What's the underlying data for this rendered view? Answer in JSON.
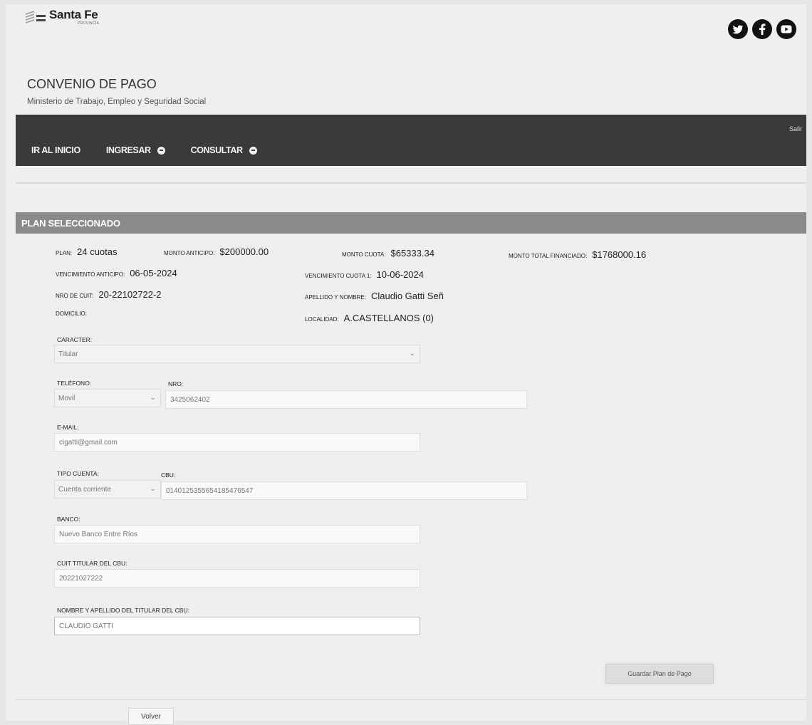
{
  "brand": {
    "name": "Santa Fe",
    "sub": "PROVINCIA"
  },
  "social_icons": [
    "twitter-icon",
    "facebook-icon",
    "youtube-icon"
  ],
  "header": {
    "title": "CONVENIO DE PAGO",
    "subtitle": "Ministerio de Trabajo, Empleo y Seguridad Social"
  },
  "nav": {
    "exit": "Salir",
    "home": "IR AL INICIO",
    "ingresar": "INGRESAR",
    "consultar": "CONSULTAR"
  },
  "section_title": "PLAN SELECCIONADO",
  "plan": {
    "plan_label": "PLAN:",
    "plan_value": "24 cuotas",
    "anticipo_label": "MONTO ANTICIPO:",
    "anticipo_value": "$200000.00",
    "cuota_label": "MONTO CUOTA:",
    "cuota_value": "$65333.34",
    "total_label": "MONTO TOTAL FINANCIADO:",
    "total_value": "$1768000.16",
    "venc_anticipo_label": "VENCIMIENTO ANTICIPO:",
    "venc_anticipo_value": "06-05-2024",
    "venc_cuota_label": "VENCIMIENTO CUOTA 1:",
    "venc_cuota_value": "10-06-2024",
    "cuit_label": "NRO DE CUIT:",
    "cuit_value": "20-22102722-2",
    "nombre_label": "APELLIDO Y NOMBRE:",
    "nombre_value": "Claudio Gatti Señ",
    "domicilio_label": "DOMICILIO:",
    "domicilio_value": "",
    "localidad_label": "LOCALIDAD:",
    "localidad_value": "A.CASTELLANOS (0)"
  },
  "form": {
    "caracter_label": "CARACTER:",
    "caracter_value": "Titular",
    "telefono_label": "TELÉFONO:",
    "telefono_value": "Movil",
    "nro_label": "NRO:",
    "nro_value": "3425062402",
    "email_label": "E-MAIL:",
    "email_value": "cigatti@gmail.com",
    "tipo_cuenta_label": "TIPO CUENTA:",
    "tipo_cuenta_value": "Cuenta corriente",
    "cbu_label": "CBU:",
    "cbu_value": "0140125355654185476547",
    "banco_label": "BANCO:",
    "banco_value": "Nuevo Banco Entre Ríos",
    "cuit_titular_label": "CUIT TITULAR DEL CBU:",
    "cuit_titular_value": "20221027222",
    "nombre_titular_label": "NOMBRE Y APELLIDO DEL TITULAR DEL CBU:",
    "nombre_titular_value": "CLAUDIO GATTI"
  },
  "buttons": {
    "save": "Guardar Plan de Pago",
    "back": "Volver"
  },
  "colors": {
    "nav_bg": "#3a3a3a",
    "section_bg": "#8a8a8a",
    "page_bg": "#efefef"
  }
}
